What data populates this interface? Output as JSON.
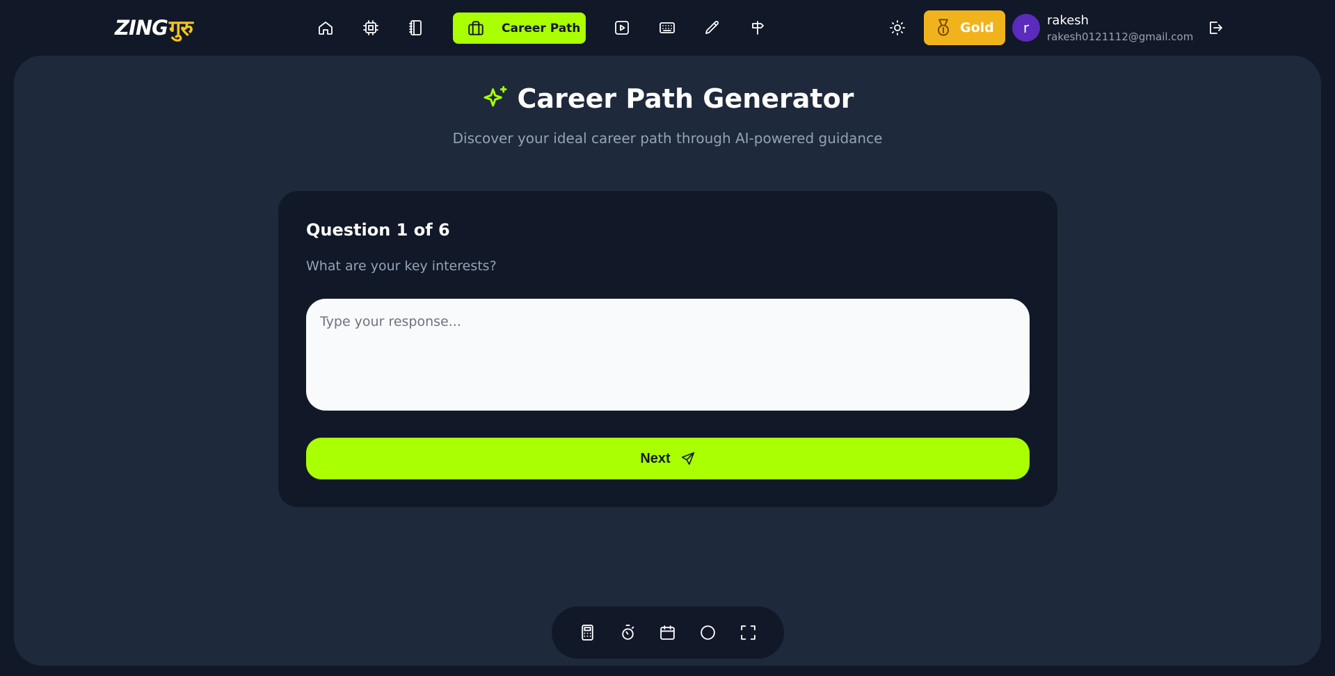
{
  "brand": {
    "logo_latin": "ZING",
    "logo_devanagari": "गुरु"
  },
  "nav": {
    "active_tab_label": "Career Path",
    "icons": [
      "home-icon",
      "cpu-icon",
      "notebook-icon",
      "briefcase-icon",
      "play-icon",
      "keyboard-icon",
      "pencil-icon",
      "signpost-icon"
    ]
  },
  "header": {
    "theme_icon": "sun-icon",
    "plan_badge": "Gold",
    "user": {
      "avatar_initial": "r",
      "name": "rakesh",
      "email": "rakesh0121112@gmail.com"
    },
    "logout_icon": "logout-icon"
  },
  "page": {
    "title": "Career Path Generator",
    "subtitle": "Discover your ideal career path through AI-powered guidance"
  },
  "question": {
    "label": "Question 1 of 6",
    "text": "What are your key interests?",
    "placeholder": "Type your response...",
    "value": "",
    "next_label": "Next"
  },
  "dock": {
    "icons": [
      "calculator-icon",
      "stopwatch-icon",
      "calendar-icon",
      "circle-icon",
      "fullscreen-icon"
    ]
  },
  "colors": {
    "accent": "#aaff00",
    "gold": "#f1b31c",
    "panel": "#1e293b",
    "background": "#111827",
    "avatar": "#5b2bbd"
  }
}
